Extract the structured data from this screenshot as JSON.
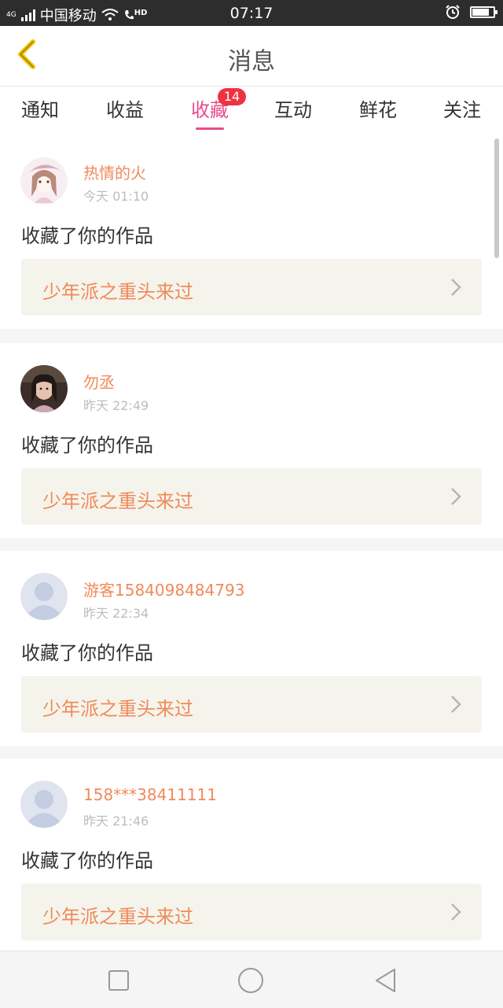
{
  "status_bar": {
    "network_tag": "4G",
    "carrier": "中国移动",
    "hd_label": "HD",
    "time": "07:17",
    "battery_level": 0.8,
    "icons": [
      "signal-icon",
      "wifi-icon",
      "hd-call-icon",
      "alarm-icon",
      "battery-icon"
    ]
  },
  "header": {
    "title": "消息",
    "back_icon": "back-chevron-icon",
    "accent_color": "#f5c400"
  },
  "tabs": [
    {
      "label": "通知",
      "active": false
    },
    {
      "label": "收益",
      "active": false
    },
    {
      "label": "收藏",
      "active": true,
      "badge": "14"
    },
    {
      "label": "互动",
      "active": false
    },
    {
      "label": "鲜花",
      "active": false
    },
    {
      "label": "关注",
      "active": false
    }
  ],
  "colors": {
    "active_tab": "#e94b8c",
    "username": "#f08a5a",
    "badge": "#ee3340",
    "work_bg": "#f5f4ec"
  },
  "items": [
    {
      "username": "热情的火",
      "time": "今天 01:10",
      "action": "收藏了你的作品",
      "work": "少年派之重头来过",
      "avatar": "anime-girl-avatar"
    },
    {
      "username": "勿丞",
      "time": "昨天 22:49",
      "action": "收藏了你的作品",
      "work": "少年派之重头来过",
      "avatar": "photo-avatar"
    },
    {
      "username": "游客1584098484793",
      "time": "昨天 22:34",
      "action": "收藏了你的作品",
      "work": "少年派之重头来过",
      "avatar": "default-avatar"
    },
    {
      "username": "158***38411111",
      "time": "昨天 21:46",
      "action": "收藏了你的作品",
      "work": "少年派之重头来过",
      "avatar": "default-avatar"
    }
  ],
  "navbar": {
    "icons": [
      "recents-square-icon",
      "home-circle-icon",
      "back-triangle-icon"
    ]
  }
}
